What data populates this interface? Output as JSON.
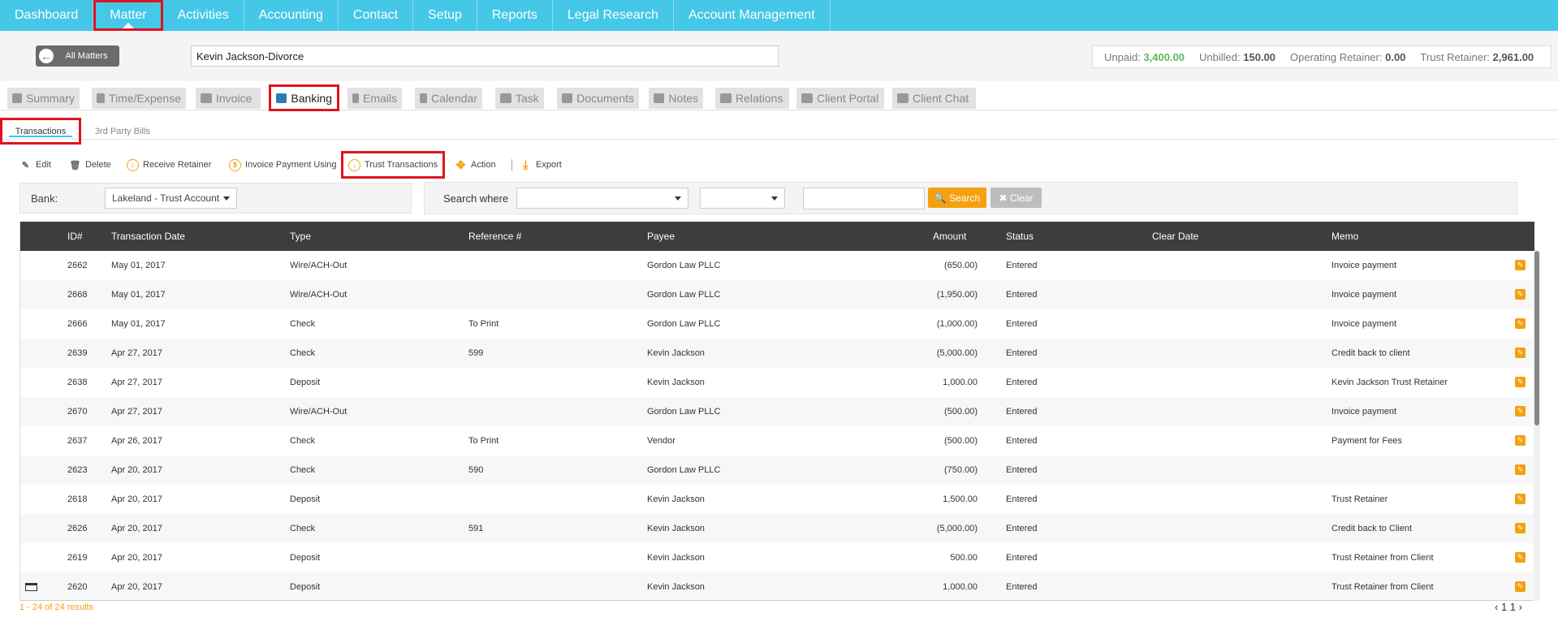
{
  "topnav": [
    "Dashboard",
    "Matter",
    "Activities",
    "Accounting",
    "Contact",
    "Setup",
    "Reports",
    "Legal Research",
    "Account Management"
  ],
  "header": {
    "all_matters": "All Matters",
    "matter_name": "Kevin Jackson-Divorce",
    "balances": {
      "unpaid_label": "Unpaid:",
      "unpaid": "3,400.00",
      "unbilled_label": "Unbilled:",
      "unbilled": "150.00",
      "operating_label": "Operating Retainer:",
      "operating": "0.00",
      "trust_label": "Trust Retainer:",
      "trust": "2,961.00"
    }
  },
  "section_tabs": [
    "Summary",
    "Time/Expense",
    "Invoice",
    "Banking",
    "Emails",
    "Calendar",
    "Task",
    "Documents",
    "Notes",
    "Relations",
    "Client Portal",
    "Client Chat"
  ],
  "sub_tabs": [
    "Transactions",
    "3rd Party Bills"
  ],
  "toolbar": {
    "edit": "Edit",
    "delete": "Delete",
    "receive_retainer": "Receive Retainer",
    "invoice_payment": "Invoice Payment Using",
    "trust_transactions": "Trust Transactions",
    "action": "Action",
    "export": "Export"
  },
  "filters": {
    "bank_label": "Bank:",
    "bank_value": "Lakeland - Trust Account",
    "search_where": "Search where",
    "search_btn": "Search",
    "clear_btn": "Clear"
  },
  "table": {
    "headers": [
      "ID#",
      "Transaction Date",
      "Type",
      "Reference #",
      "Payee",
      "Amount",
      "Status",
      "Clear Date",
      "Memo"
    ],
    "rows": [
      {
        "id": "2662",
        "date": "May 01, 2017",
        "type": "Wire/ACH-Out",
        "ref": "",
        "payee": "Gordon Law PLLC",
        "amount": "(650.00)",
        "status": "Entered",
        "clear": "",
        "memo": "Invoice payment"
      },
      {
        "id": "2668",
        "date": "May 01, 2017",
        "type": "Wire/ACH-Out",
        "ref": "",
        "payee": "Gordon Law PLLC",
        "amount": "(1,950.00)",
        "status": "Entered",
        "clear": "",
        "memo": "Invoice payment"
      },
      {
        "id": "2666",
        "date": "May 01, 2017",
        "type": "Check",
        "ref": "To Print",
        "payee": "Gordon Law PLLC",
        "amount": "(1,000.00)",
        "status": "Entered",
        "clear": "",
        "memo": "Invoice payment"
      },
      {
        "id": "2639",
        "date": "Apr 27, 2017",
        "type": "Check",
        "ref": "599",
        "payee": "Kevin Jackson",
        "amount": "(5,000.00)",
        "status": "Entered",
        "clear": "",
        "memo": "Credit back to client"
      },
      {
        "id": "2638",
        "date": "Apr 27, 2017",
        "type": "Deposit",
        "ref": "",
        "payee": "Kevin Jackson",
        "amount": "1,000.00",
        "status": "Entered",
        "clear": "",
        "memo": "Kevin Jackson Trust Retainer"
      },
      {
        "id": "2670",
        "date": "Apr 27, 2017",
        "type": "Wire/ACH-Out",
        "ref": "",
        "payee": "Gordon Law PLLC",
        "amount": "(500.00)",
        "status": "Entered",
        "clear": "",
        "memo": "Invoice payment"
      },
      {
        "id": "2637",
        "date": "Apr 26, 2017",
        "type": "Check",
        "ref": "To Print",
        "payee": "Vendor",
        "amount": "(500.00)",
        "status": "Entered",
        "clear": "",
        "memo": "Payment for Fees"
      },
      {
        "id": "2623",
        "date": "Apr 20, 2017",
        "type": "Check",
        "ref": "590",
        "payee": "Gordon Law PLLC",
        "amount": "(750.00)",
        "status": "Entered",
        "clear": "",
        "memo": ""
      },
      {
        "id": "2618",
        "date": "Apr 20, 2017",
        "type": "Deposit",
        "ref": "",
        "payee": "Kevin Jackson",
        "amount": "1,500.00",
        "status": "Entered",
        "clear": "",
        "memo": "Trust Retainer"
      },
      {
        "id": "2626",
        "date": "Apr 20, 2017",
        "type": "Check",
        "ref": "591",
        "payee": "Kevin Jackson",
        "amount": "(5,000.00)",
        "status": "Entered",
        "clear": "",
        "memo": "Credit back to Client"
      },
      {
        "id": "2619",
        "date": "Apr 20, 2017",
        "type": "Deposit",
        "ref": "",
        "payee": "Kevin Jackson",
        "amount": "500.00",
        "status": "Entered",
        "clear": "",
        "memo": "Trust Retainer from Client"
      },
      {
        "id": "2620",
        "date": "Apr 20, 2017",
        "type": "Deposit",
        "ref": "",
        "payee": "Kevin Jackson",
        "amount": "1,000.00",
        "status": "Entered",
        "clear": "",
        "memo": "Trust Retainer from Client"
      }
    ]
  },
  "footer": {
    "results": "1 - 24 of 24 results",
    "pager": "‹ 1 1 ›"
  },
  "colors": {
    "accent": "#45c7e8",
    "highlight": "#e0141e",
    "orange": "#f5a00f",
    "green": "#5cb85c"
  }
}
